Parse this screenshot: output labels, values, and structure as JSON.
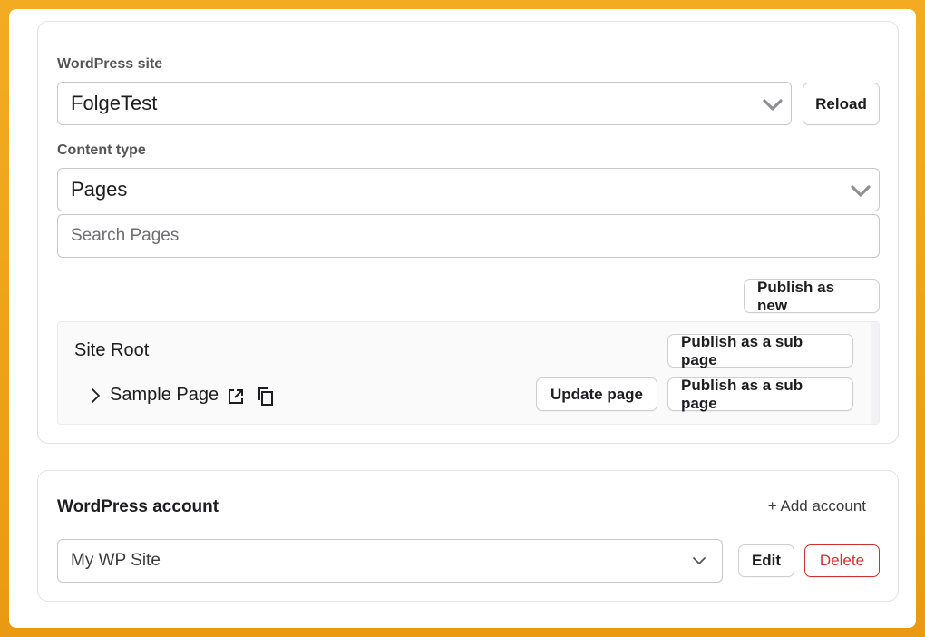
{
  "site_section": {
    "site_label": "WordPress site",
    "site_value": "FolgeTest",
    "reload_label": "Reload",
    "content_type_label": "Content type",
    "content_type_value": "Pages",
    "search_placeholder": "Search Pages",
    "publish_new_label": "Publish as new",
    "tree": {
      "root_label": "Site Root",
      "root_publish_sub_label": "Publish as a sub page",
      "items": [
        {
          "title": "Sample Page",
          "update_label": "Update page",
          "publish_sub_label": "Publish as a sub page"
        }
      ]
    }
  },
  "account_section": {
    "title": "WordPress account",
    "add_label": "+ Add account",
    "account_value": "My WP Site",
    "edit_label": "Edit",
    "delete_label": "Delete"
  },
  "icons": {
    "select_chevron": "chevron-down-icon",
    "expand": "chevron-right-icon",
    "open_external": "external-link-icon",
    "copy": "copy-icon"
  },
  "colors": {
    "background": "#f0a51c",
    "delete_accent": "#d0312d"
  }
}
